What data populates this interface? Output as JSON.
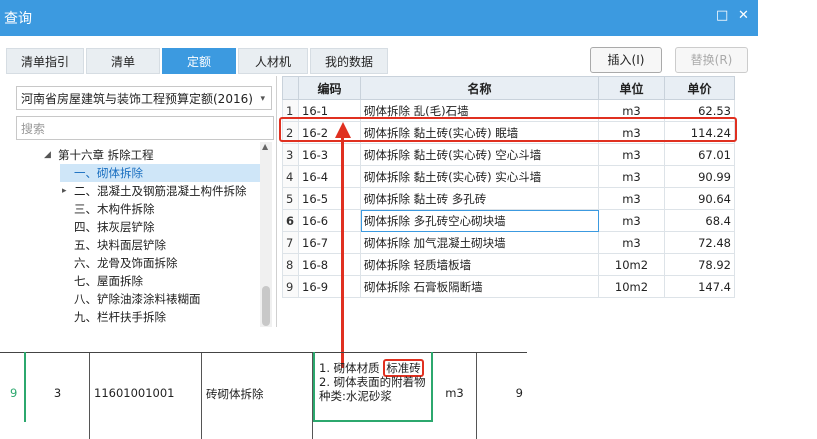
{
  "window": {
    "title": "查询",
    "restore_glyph": "□",
    "close_glyph": "✕"
  },
  "tabs": [
    {
      "label": "清单指引",
      "active": false
    },
    {
      "label": "清单",
      "active": false
    },
    {
      "label": "定额",
      "active": true
    },
    {
      "label": "人材机",
      "active": false
    },
    {
      "label": "我的数据",
      "active": false
    }
  ],
  "buttons": {
    "insert": "插入(I)",
    "replace": "替换(R)"
  },
  "left": {
    "quota_lib": "河南省房屋建筑与装饰工程预算定额(2016)",
    "search_placeholder": "搜索",
    "tree": [
      {
        "label": "第十六章 拆除工程",
        "expander": "◢"
      },
      {
        "label": "一、砌体拆除",
        "expander": ""
      },
      {
        "label": "二、混凝土及钢筋混凝土构件拆除",
        "expander": "▸"
      },
      {
        "label": "三、木构件拆除",
        "expander": ""
      },
      {
        "label": "四、抹灰层铲除",
        "expander": ""
      },
      {
        "label": "五、块料面层铲除",
        "expander": ""
      },
      {
        "label": "六、龙骨及饰面拆除",
        "expander": ""
      },
      {
        "label": "七、屋面拆除",
        "expander": ""
      },
      {
        "label": "八、铲除油漆涂料裱糊面",
        "expander": ""
      },
      {
        "label": "九、栏杆扶手拆除",
        "expander": ""
      }
    ]
  },
  "grid": {
    "headers": {
      "code": "编码",
      "name": "名称",
      "unit": "单位",
      "price": "单价"
    },
    "rows": [
      {
        "n": "1",
        "code": "16-1",
        "name": "砌体拆除 乱(毛)石墙",
        "unit": "m3",
        "price": "62.53"
      },
      {
        "n": "2",
        "code": "16-2",
        "name": "砌体拆除 黏土砖(实心砖) 眠墙",
        "unit": "m3",
        "price": "114.24"
      },
      {
        "n": "3",
        "code": "16-3",
        "name": "砌体拆除 黏土砖(实心砖) 空心斗墙",
        "unit": "m3",
        "price": "67.01"
      },
      {
        "n": "4",
        "code": "16-4",
        "name": "砌体拆除 黏土砖(实心砖) 实心斗墙",
        "unit": "m3",
        "price": "90.99"
      },
      {
        "n": "5",
        "code": "16-5",
        "name": "砌体拆除 黏土砖 多孔砖",
        "unit": "m3",
        "price": "90.64"
      },
      {
        "n": "6",
        "code": "16-6",
        "name": "砌体拆除 多孔砖空心砌块墙",
        "unit": "m3",
        "price": "68.4"
      },
      {
        "n": "7",
        "code": "16-7",
        "name": "砌体拆除 加气混凝土砌块墙",
        "unit": "m3",
        "price": "72.48"
      },
      {
        "n": "8",
        "code": "16-8",
        "name": "砌体拆除 轻质墙板墙",
        "unit": "10m2",
        "price": "78.92"
      },
      {
        "n": "9",
        "code": "16-9",
        "name": "砌体拆除 石膏板隔断墙",
        "unit": "10m2",
        "price": "147.4"
      }
    ]
  },
  "bottom_row": {
    "row_no": "9",
    "seq": "3",
    "code": "11601001001",
    "name": "砖砌体拆除",
    "feature_line1_prefix": "1. 砌体材质",
    "feature_highlight": "标准砖",
    "feature_line2": "2. 砌体表面的附着物种类:水泥砂浆",
    "unit": "m3",
    "qty": "9"
  },
  "colors": {
    "accent": "#3c9ae0",
    "annotation_red": "#e03020",
    "annotation_green": "#2ca86e"
  }
}
